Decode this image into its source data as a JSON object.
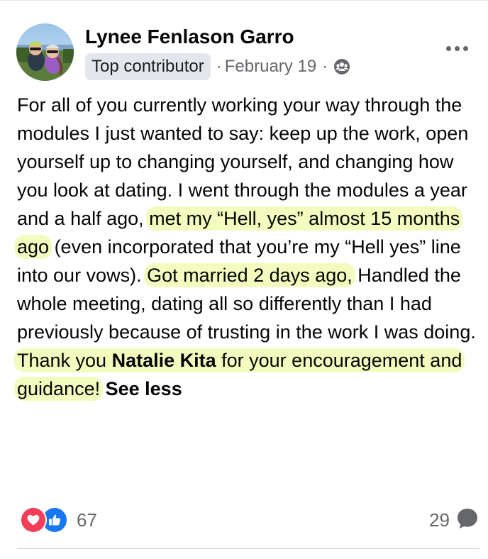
{
  "post": {
    "author": {
      "name": "Lynee Fenlason Garro",
      "badge": "Top contributor"
    },
    "meta": {
      "separator": "·",
      "date": "February 19",
      "privacy_icon": "group-icon"
    },
    "more_icon": "more-options-icon",
    "body": {
      "t1": "For all of you currently working your way through the modules I just wanted to say: keep up the work, open yourself up to changing yourself, and changing how you look at dating. I went through the modules a year and a half ago, ",
      "h1": "met my “Hell, yes” almost 15 months ago",
      "t2": " (even incorporated that you’re my “Hell yes” line into our vows). ",
      "h2": "Got married 2 days ago,",
      "t3": " Handled the whole meeting, dating all so differently than I had previously because of trusting in the work I was doing. ",
      "h3a": "Thank you ",
      "mention": "Natalie Kita",
      "h3b": " for your encouragement and guidance!",
      "see_less": "See less"
    },
    "highlight_color": "#ecf896",
    "reactions": {
      "icons": [
        "love-reaction-icon",
        "like-reaction-icon"
      ],
      "count": "67"
    },
    "comments": {
      "count": "29",
      "icon": "comment-bubble-icon"
    }
  }
}
